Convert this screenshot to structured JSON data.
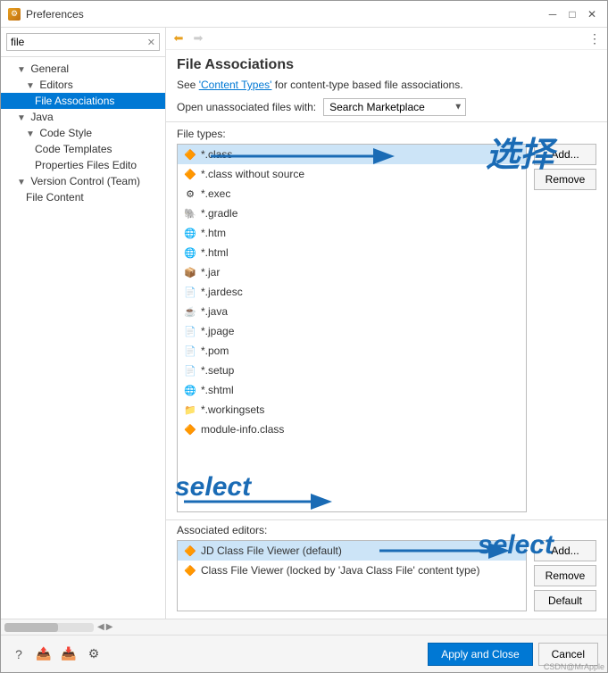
{
  "window": {
    "title": "Preferences",
    "icon": "⚙"
  },
  "sidebar": {
    "search_placeholder": "file",
    "search_value": "file",
    "items": [
      {
        "id": "general",
        "label": "General",
        "indent": 1,
        "expanded": true,
        "selected": false
      },
      {
        "id": "editors",
        "label": "Editors",
        "indent": 2,
        "expanded": true,
        "selected": false
      },
      {
        "id": "file-associations",
        "label": "File Associations",
        "indent": 3,
        "selected": true
      },
      {
        "id": "java",
        "label": "Java",
        "indent": 1,
        "expanded": true,
        "selected": false
      },
      {
        "id": "code-style",
        "label": "Code Style",
        "indent": 2,
        "expanded": true,
        "selected": false
      },
      {
        "id": "code-templates",
        "label": "Code Templates",
        "indent": 3,
        "selected": false
      },
      {
        "id": "properties-files",
        "label": "Properties Files Edito",
        "indent": 3,
        "selected": false
      },
      {
        "id": "version-control",
        "label": "Version Control (Team)",
        "indent": 1,
        "expanded": true,
        "selected": false
      },
      {
        "id": "file-content",
        "label": "File Content",
        "indent": 2,
        "selected": false
      }
    ]
  },
  "main": {
    "panel_title": "File Associations",
    "content_types_text": "See ",
    "content_types_link": "'Content Types'",
    "content_types_suffix": " for content-type based file associations.",
    "open_unassoc_label": "Open unassociated files with:",
    "marketplace_value": "Search Marketplace",
    "file_types_label": "File types:",
    "associated_editors_label": "Associated editors:",
    "file_types": [
      {
        "icon": "🔶",
        "name": "*.class",
        "selected": true
      },
      {
        "icon": "🔶",
        "name": "*.class without source",
        "selected": false
      },
      {
        "icon": "⚙",
        "name": "*.exec",
        "selected": false
      },
      {
        "icon": "🐘",
        "name": "*.gradle",
        "selected": false
      },
      {
        "icon": "🌐",
        "name": "*.htm",
        "selected": false
      },
      {
        "icon": "🌐",
        "name": "*.html",
        "selected": false
      },
      {
        "icon": "📦",
        "name": "*.jar",
        "selected": false
      },
      {
        "icon": "📄",
        "name": "*.jardesc",
        "selected": false
      },
      {
        "icon": "☕",
        "name": "*.java",
        "selected": false
      },
      {
        "icon": "📄",
        "name": "*.jpage",
        "selected": false
      },
      {
        "icon": "📄",
        "name": "*.pom",
        "selected": false
      },
      {
        "icon": "📄",
        "name": "*.setup",
        "selected": false
      },
      {
        "icon": "🌐",
        "name": "*.shtml",
        "selected": false
      },
      {
        "icon": "📁",
        "name": "*.workingsets",
        "selected": false
      },
      {
        "icon": "🔶",
        "name": "module-info.class",
        "selected": false
      }
    ],
    "buttons_file_types": {
      "add": "Add...",
      "remove": "Remove"
    },
    "associated_editors": [
      {
        "icon": "🔶",
        "name": "JD Class File Viewer (default)",
        "selected": true
      },
      {
        "icon": "🔶",
        "name": "Class File Viewer (locked by 'Java Class File' content type)",
        "selected": false
      }
    ],
    "buttons_assoc": {
      "add": "Add...",
      "remove": "Remove",
      "default": "Default"
    }
  },
  "annotations": {
    "select1": "选择",
    "select2": "select",
    "select3": "select"
  },
  "footer": {
    "apply_close": "Apply and Close",
    "cancel": "Cancel"
  },
  "copyright": "CSDN@MrApple"
}
